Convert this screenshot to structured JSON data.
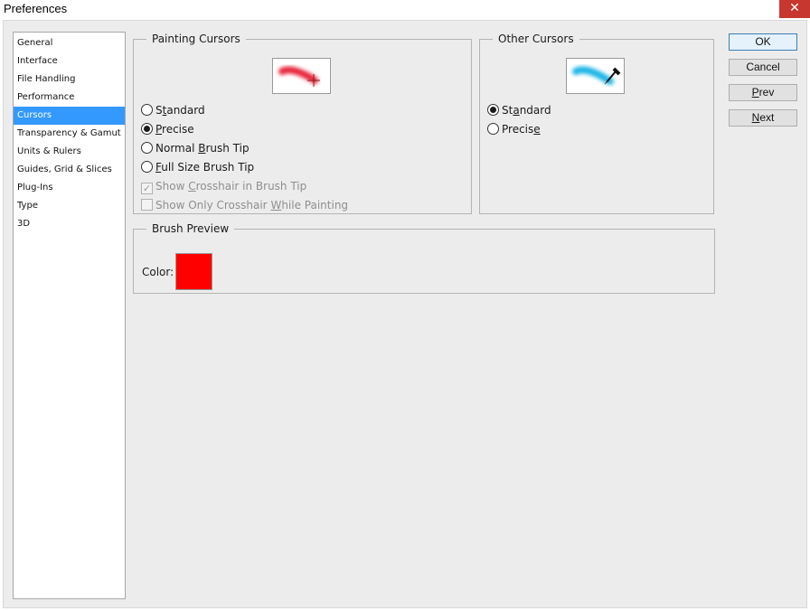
{
  "window": {
    "title": "Preferences",
    "close_glyph": "✕"
  },
  "sidebar": {
    "items": [
      {
        "label": "General"
      },
      {
        "label": "Interface"
      },
      {
        "label": "File Handling"
      },
      {
        "label": "Performance"
      },
      {
        "label": "Cursors",
        "selected": true
      },
      {
        "label": "Transparency & Gamut"
      },
      {
        "label": "Units & Rulers"
      },
      {
        "label": "Guides, Grid & Slices"
      },
      {
        "label": "Plug-Ins"
      },
      {
        "label": "Type"
      },
      {
        "label": "3D"
      }
    ]
  },
  "painting_cursors": {
    "legend": "Painting Cursors",
    "preview_icon": "red-brush-stroke-with-crosshair",
    "options": {
      "standard": {
        "pre": "S",
        "ul": "t",
        "post": "andard",
        "checked": false
      },
      "precise": {
        "pre": "",
        "ul": "P",
        "post": "recise",
        "checked": true
      },
      "normal_brush_tip": {
        "pre": "Normal ",
        "ul": "B",
        "post": "rush Tip",
        "checked": false
      },
      "full_size_brush_tip": {
        "pre": "",
        "ul": "F",
        "post": "ull Size Brush Tip",
        "checked": false
      }
    },
    "show_crosshair": {
      "pre": "Show ",
      "ul": "C",
      "post": "rosshair in Brush Tip",
      "checked": true,
      "enabled": false
    },
    "show_only_crosshair": {
      "pre": "Show Only Crosshair ",
      "ul": "W",
      "post": "hile Painting",
      "checked": false,
      "enabled": false
    }
  },
  "other_cursors": {
    "legend": "Other Cursors",
    "preview_icon": "cyan-stroke-with-eyedropper",
    "options": {
      "standard": {
        "pre": "St",
        "ul": "a",
        "post": "ndard",
        "checked": true
      },
      "precise": {
        "pre": "Precis",
        "ul": "e",
        "post": "",
        "checked": false
      }
    }
  },
  "brush_preview": {
    "legend": "Brush Preview",
    "color_label": "Color:",
    "color": "#ff0000"
  },
  "buttons": {
    "ok": {
      "pre": "OK",
      "ul": "",
      "post": ""
    },
    "cancel": {
      "pre": "Cancel",
      "ul": "",
      "post": ""
    },
    "prev": {
      "pre": "",
      "ul": "P",
      "post": "rev"
    },
    "next": {
      "pre": "",
      "ul": "N",
      "post": "ext"
    }
  },
  "colors": {
    "selection": "#3399ff",
    "close_button": "#c7372f",
    "painting_stroke": "#e8283c",
    "other_stroke": "#1fb6e6"
  }
}
